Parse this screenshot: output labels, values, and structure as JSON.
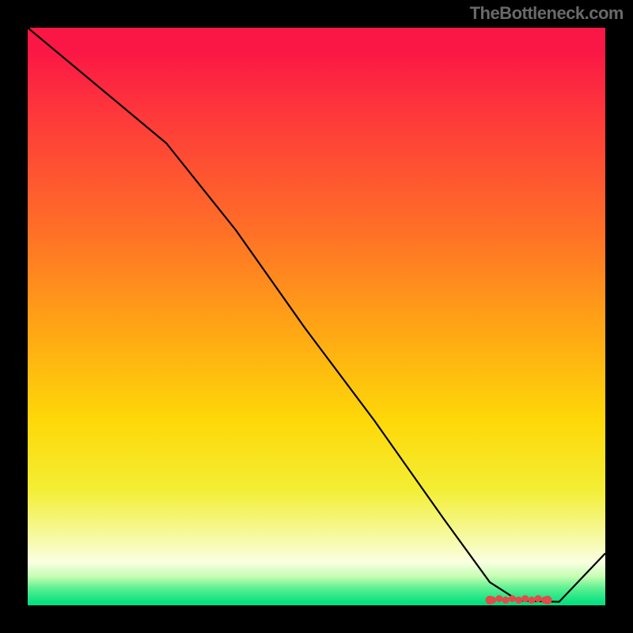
{
  "attribution": "TheBottleneck.com",
  "chart_data": {
    "type": "line",
    "title": "",
    "xlabel": "",
    "ylabel": "",
    "xlim": [
      0,
      100
    ],
    "ylim": [
      0,
      100
    ],
    "x": [
      0,
      12,
      24,
      36,
      48,
      60,
      72,
      80,
      85,
      92,
      100
    ],
    "values": [
      100,
      90,
      80,
      65,
      48,
      32,
      15,
      4,
      0.8,
      0.6,
      9
    ],
    "markers": {
      "x_range": [
        80.5,
        89.5
      ],
      "y": 0.9,
      "count": 9,
      "color": "#e24b4a"
    },
    "line_color": "#000000",
    "line_width": 2.2
  }
}
